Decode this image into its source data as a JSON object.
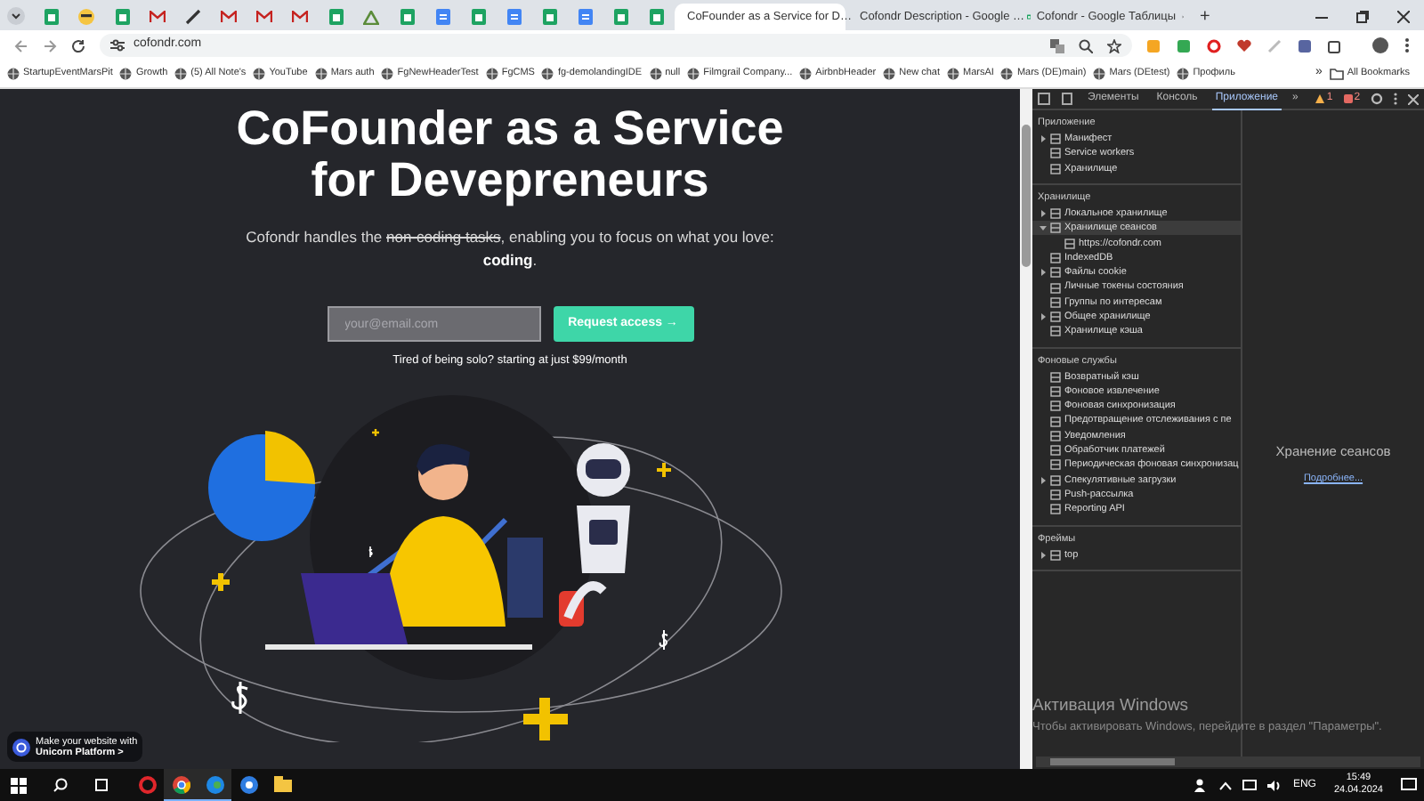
{
  "browser": {
    "pinned_tabs": [
      {
        "kind": "sheets"
      },
      {
        "kind": "emoji"
      },
      {
        "kind": "sheets"
      },
      {
        "kind": "mail"
      },
      {
        "kind": "pen"
      },
      {
        "kind": "mail"
      },
      {
        "kind": "mail"
      },
      {
        "kind": "mail"
      },
      {
        "kind": "sheets"
      },
      {
        "kind": "drive"
      },
      {
        "kind": "sheets"
      },
      {
        "kind": "docs"
      },
      {
        "kind": "sheets"
      },
      {
        "kind": "docs"
      },
      {
        "kind": "sheets"
      },
      {
        "kind": "docs"
      },
      {
        "kind": "sheets"
      },
      {
        "kind": "sheets"
      }
    ],
    "tabs": [
      {
        "label": "CoFounder as a Service for D…",
        "kind": "site",
        "selected": true
      },
      {
        "label": "Cofondr Description - Google …",
        "kind": "docs",
        "selected": false
      },
      {
        "label": "Cofondr - Google Таблицы",
        "kind": "sheets",
        "selected": false
      }
    ],
    "new_tab": "+",
    "url": "cofondr.com",
    "bookmarks": [
      {
        "label": "StartupEventMarsPit"
      },
      {
        "label": "Growth"
      },
      {
        "label": "(5) All Note's"
      },
      {
        "label": "YouTube"
      },
      {
        "label": "Mars auth"
      },
      {
        "label": "FgNewHeaderTest"
      },
      {
        "label": "FgCMS"
      },
      {
        "label": "fg-demolandingIDE"
      },
      {
        "label": "null"
      },
      {
        "label": "Filmgrail Company..."
      },
      {
        "label": "AirbnbHeader"
      },
      {
        "label": "New chat"
      },
      {
        "label": "MarsAI"
      },
      {
        "label": "Mars (DE)main)"
      },
      {
        "label": "Mars (DEtest)"
      },
      {
        "label": "Профиль"
      }
    ],
    "more_bookmarks": "»",
    "all_bookmarks": "All Bookmarks"
  },
  "page": {
    "title": [
      "CoFounder as a Service",
      "for Devepreneurs"
    ],
    "subtitle": [
      {
        "text": "Cofondr handles the ",
        "kind": "plain"
      },
      {
        "text": "non-coding tasks",
        "kind": "strike"
      },
      {
        "text": ", enabling you to focus on what you love: ",
        "kind": "plain"
      },
      {
        "text": "coding",
        "kind": "bold"
      },
      {
        "text": ".",
        "kind": "plain"
      }
    ],
    "email_placeholder": "your@email.com",
    "cta": "Request access →",
    "note": "Tired of being solo? starting at just $99/month",
    "badge": [
      "Make your website with",
      "Unicorn Platform >"
    ]
  },
  "devtools": {
    "tabs": [
      {
        "label": "Элементы",
        "selected": false
      },
      {
        "label": "Консоль",
        "selected": false
      },
      {
        "label": "Приложение",
        "selected": true
      }
    ],
    "more_tabs": "»",
    "warnings": "1",
    "errors": "2",
    "sections": [
      {
        "title": "Приложение",
        "items": [
          {
            "label": "Манифест",
            "kind": "group",
            "expanded": false,
            "selected": false
          },
          {
            "label": "Service workers",
            "kind": "item",
            "selected": false
          },
          {
            "label": "Хранилище",
            "kind": "item",
            "selected": false
          }
        ]
      },
      {
        "title": "Хранилище",
        "items": [
          {
            "label": "Локальное хранилище",
            "kind": "group",
            "expanded": false,
            "selected": false
          },
          {
            "label": "Хранилище сеансов",
            "kind": "group",
            "expanded": true,
            "selected": true,
            "children": [
              {
                "label": "https://cofondr.com",
                "selected": false
              }
            ]
          },
          {
            "label": "IndexedDB",
            "kind": "item",
            "selected": false
          },
          {
            "label": "Файлы cookie",
            "kind": "group",
            "expanded": false,
            "selected": false
          },
          {
            "label": "Личные токены состояния",
            "kind": "item",
            "selected": false
          },
          {
            "label": "Группы по интересам",
            "kind": "item",
            "selected": false
          },
          {
            "label": "Общее хранилище",
            "kind": "group",
            "expanded": false,
            "selected": false
          },
          {
            "label": "Хранилище кэша",
            "kind": "item",
            "selected": false
          }
        ]
      },
      {
        "title": "Фоновые службы",
        "items": [
          {
            "label": "Возвратный кэш",
            "kind": "item",
            "selected": false
          },
          {
            "label": "Фоновое извлечение",
            "kind": "item",
            "selected": false
          },
          {
            "label": "Фоновая синхронизация",
            "kind": "item",
            "selected": false
          },
          {
            "label": "Предотвращение отслеживания с пе",
            "kind": "item",
            "selected": false
          },
          {
            "label": "Уведомления",
            "kind": "item",
            "selected": false
          },
          {
            "label": "Обработчик платежей",
            "kind": "item",
            "selected": false
          },
          {
            "label": "Периодическая фоновая синхронизац",
            "kind": "item",
            "selected": false
          },
          {
            "label": "Спекулятивные загрузки",
            "kind": "group",
            "expanded": false,
            "selected": false
          },
          {
            "label": "Push-рассылка",
            "kind": "item",
            "selected": false
          },
          {
            "label": "Reporting API",
            "kind": "item",
            "selected": false
          }
        ]
      },
      {
        "title": "Фреймы",
        "items": [
          {
            "label": "top",
            "kind": "group",
            "expanded": false,
            "selected": false
          }
        ]
      }
    ],
    "pane_title": "Хранение сеансов",
    "pane_link": "Подробнее..."
  },
  "activation": {
    "title": "Активация Windows",
    "text": "Чтобы активировать Windows, перейдите в раздел \"Параметры\"."
  },
  "taskbar": {
    "language": "ENG",
    "time": "15:49",
    "date": "24.04.2024"
  }
}
